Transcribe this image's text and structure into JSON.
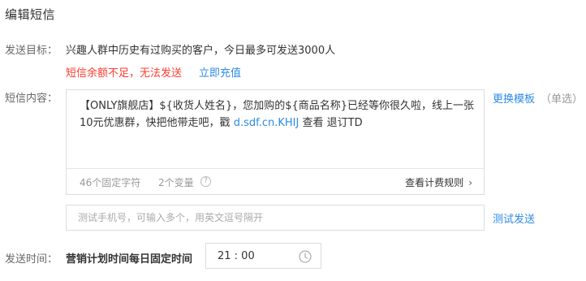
{
  "page_title": "编辑短信",
  "target": {
    "label": "发送目标：",
    "text": "兴趣人群中历史有过购买的客户，今日最多可发送3000人",
    "warning": "短信余额不足，无法发送",
    "recharge_link": "立即充值"
  },
  "content": {
    "label": "短信内容：",
    "message_text": "【ONLY旗舰店】${收货人姓名}，您加购的${商品名称}已经等你很久啦，线上一张10元优惠群，快把他带走吧，戳",
    "message_link": "d.sdf.cn.KHIJ",
    "message_tail": "查看 退订TD",
    "fixed_chars": "46个固定字符",
    "variables": "2个变量",
    "help_glyph": "?",
    "billing_rules": "查看计费规则",
    "billing_chevron": "›",
    "change_template": "更换模板",
    "single_choice": "（单选）"
  },
  "test": {
    "phone_placeholder": "测试手机号，可输入多个，用英文逗号隔开",
    "phone_value": "",
    "test_send": "测试发送"
  },
  "time": {
    "label": "发送时间：",
    "description": "营销计划时间每日固定时间",
    "value": "21 : 00"
  },
  "colors": {
    "link": "#2e8ae6",
    "warning": "#ff3b30",
    "muted": "#999999",
    "border": "#dcdcdc"
  },
  "icons": {
    "help": "help-circle-icon",
    "chevron": "chevron-right-icon",
    "clock": "clock-icon"
  }
}
